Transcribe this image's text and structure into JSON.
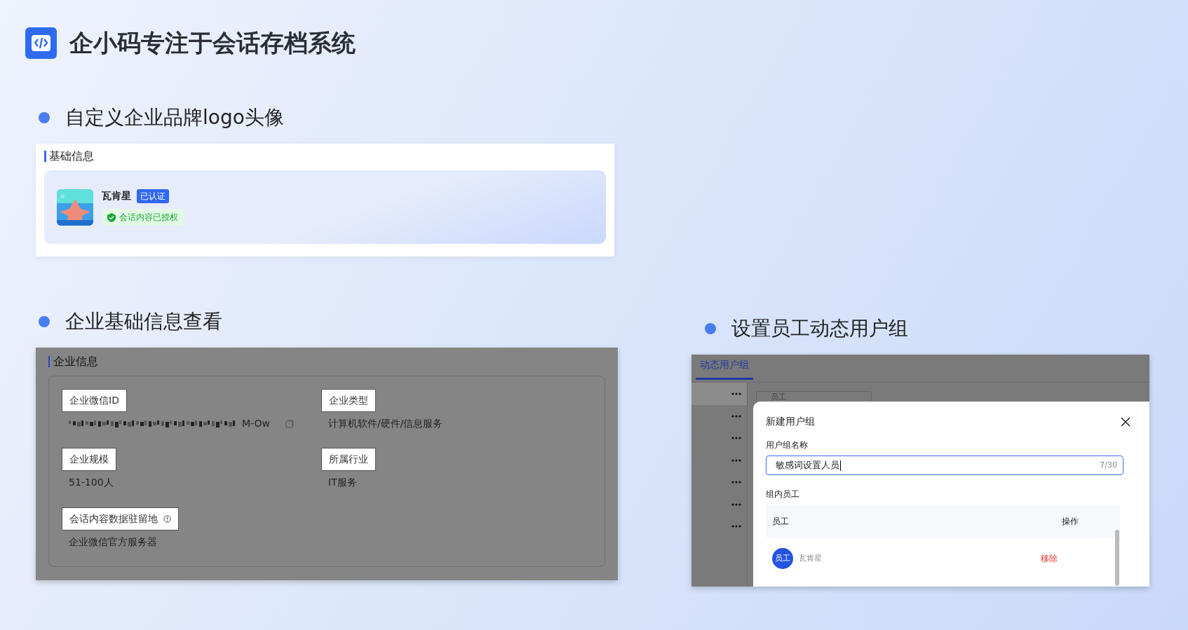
{
  "header": {
    "title": "企小码专注于会话存档系统"
  },
  "brand_section": {
    "heading": "自定义企业品牌logo头像",
    "panel_title": "基础信息",
    "company_name": "瓦肯星",
    "verified_badge": "已认证",
    "auth_status": "会话内容已授权"
  },
  "info_section": {
    "heading": "企业基础信息查看",
    "panel_title": "企业信息",
    "fields": [
      {
        "label": "企业微信ID",
        "value": "M-Ow",
        "redacted": true,
        "copy": true
      },
      {
        "label": "企业类型",
        "value": "计算机软件/硬件/信息服务",
        "redacted": false,
        "copy": false
      },
      {
        "label": "企业规模",
        "value": "51-100人",
        "redacted": false,
        "copy": false
      },
      {
        "label": "所属行业",
        "value": "IT服务",
        "redacted": false,
        "copy": false
      },
      {
        "label": "会话内容数据驻留地",
        "value": "企业微信官方服务器",
        "redacted": false,
        "copy": false,
        "info": true
      }
    ]
  },
  "group_section": {
    "heading": "设置员工动态用户组",
    "tab": "动态用户组",
    "search_placeholder": "员工",
    "dialog": {
      "title": "新建用户组",
      "name_label": "用户组名称",
      "name_value": "敏感词设置人员",
      "counter": "7/30",
      "members_label": "组内员工",
      "columns": [
        "员工",
        "操作"
      ],
      "rows": [
        {
          "avatar": "员工",
          "name": "瓦肯星",
          "action": "移除"
        }
      ]
    }
  }
}
